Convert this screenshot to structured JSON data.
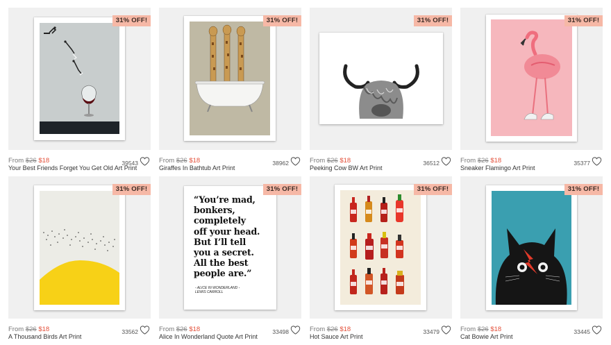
{
  "products": [
    {
      "badge": "31% OFF!",
      "from": "From",
      "old_price": "$26",
      "new_price": "$18",
      "title": "Your Best Friends Forget You Get Old Art Print",
      "count": "39543",
      "icon": "heart-icon"
    },
    {
      "badge": "31% OFF!",
      "from": "From",
      "old_price": "$26",
      "new_price": "$18",
      "title": "Giraffes In Bathtub Art Print",
      "count": "38962",
      "icon": "heart-icon"
    },
    {
      "badge": "31% OFF!",
      "from": "From",
      "old_price": "$26",
      "new_price": "$18",
      "title": "Peeking Cow BW Art Print",
      "count": "36512",
      "icon": "heart-icon"
    },
    {
      "badge": "31% OFF!",
      "from": "From",
      "old_price": "$26",
      "new_price": "$18",
      "title": "Sneaker Flamingo Art Print",
      "count": "35377",
      "icon": "heart-icon"
    },
    {
      "badge": "31% OFF!",
      "from": "From",
      "old_price": "$26",
      "new_price": "$18",
      "title": "A Thousand Birds Art Print",
      "count": "33562",
      "icon": "heart-icon"
    },
    {
      "badge": "31% OFF!",
      "from": "From",
      "old_price": "$26",
      "new_price": "$18",
      "title": "Alice In Wonderland Quote Art Print",
      "count": "33498",
      "icon": "heart-icon",
      "artwork": {
        "quote_lines": [
          "“You’re mad,",
          "bonkers,",
          "completely",
          "off your head.",
          "But I’ll tell",
          "you a secret.",
          "All the best",
          "people are.”"
        ],
        "attribution_1": "- ALICE IN WONDERLAND -",
        "attribution_2": "LEWIS CARROLL"
      }
    },
    {
      "badge": "31% OFF!",
      "from": "From",
      "old_price": "$26",
      "new_price": "$18",
      "title": "Hot Sauce Art Print",
      "count": "33479",
      "icon": "heart-icon"
    },
    {
      "badge": "31% OFF!",
      "from": "From",
      "old_price": "$26",
      "new_price": "$18",
      "title": "Cat Bowie Art Print",
      "count": "33445",
      "icon": "heart-icon"
    }
  ],
  "colors": {
    "badge_bg": "#f6b8a6",
    "sale_price": "#e3503a",
    "tile_bg": "#f0f0f0"
  }
}
